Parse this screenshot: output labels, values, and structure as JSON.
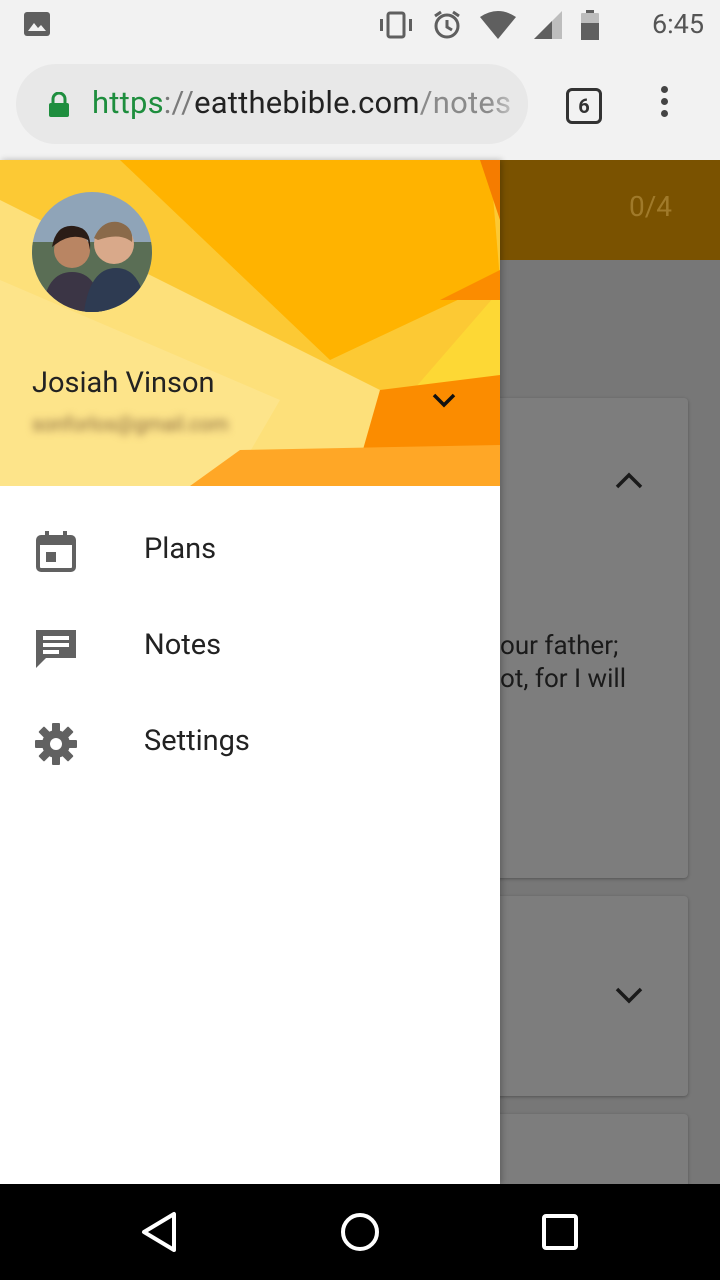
{
  "status_bar": {
    "time": "6:45",
    "icons": [
      "image-icon",
      "vibrate-icon",
      "alarm-icon",
      "wifi-icon",
      "signal-icon",
      "battery-icon"
    ]
  },
  "browser": {
    "url_scheme": "https",
    "url_separator": "://",
    "url_host": "eatthebible.com",
    "url_path": "/notes",
    "tab_count": "6",
    "secure_color": "#1e8e3e"
  },
  "page": {
    "progress": "0/4",
    "card_text_line1": "our father;",
    "card_text_line2": "ot, for I will"
  },
  "drawer": {
    "user_name": "Josiah Vinson",
    "user_email": "sonforlos@gmail.com",
    "nav_items": [
      {
        "label": "Plans",
        "icon": "calendar-icon"
      },
      {
        "label": "Notes",
        "icon": "notes-icon"
      },
      {
        "label": "Settings",
        "icon": "gear-icon"
      }
    ]
  },
  "colors": {
    "header_dark": "#7a5200",
    "drawer_accent_1": "#ffb300",
    "drawer_accent_2": "#fdd835",
    "drawer_accent_3": "#fb8c00",
    "scrim_gray": "#777777"
  }
}
